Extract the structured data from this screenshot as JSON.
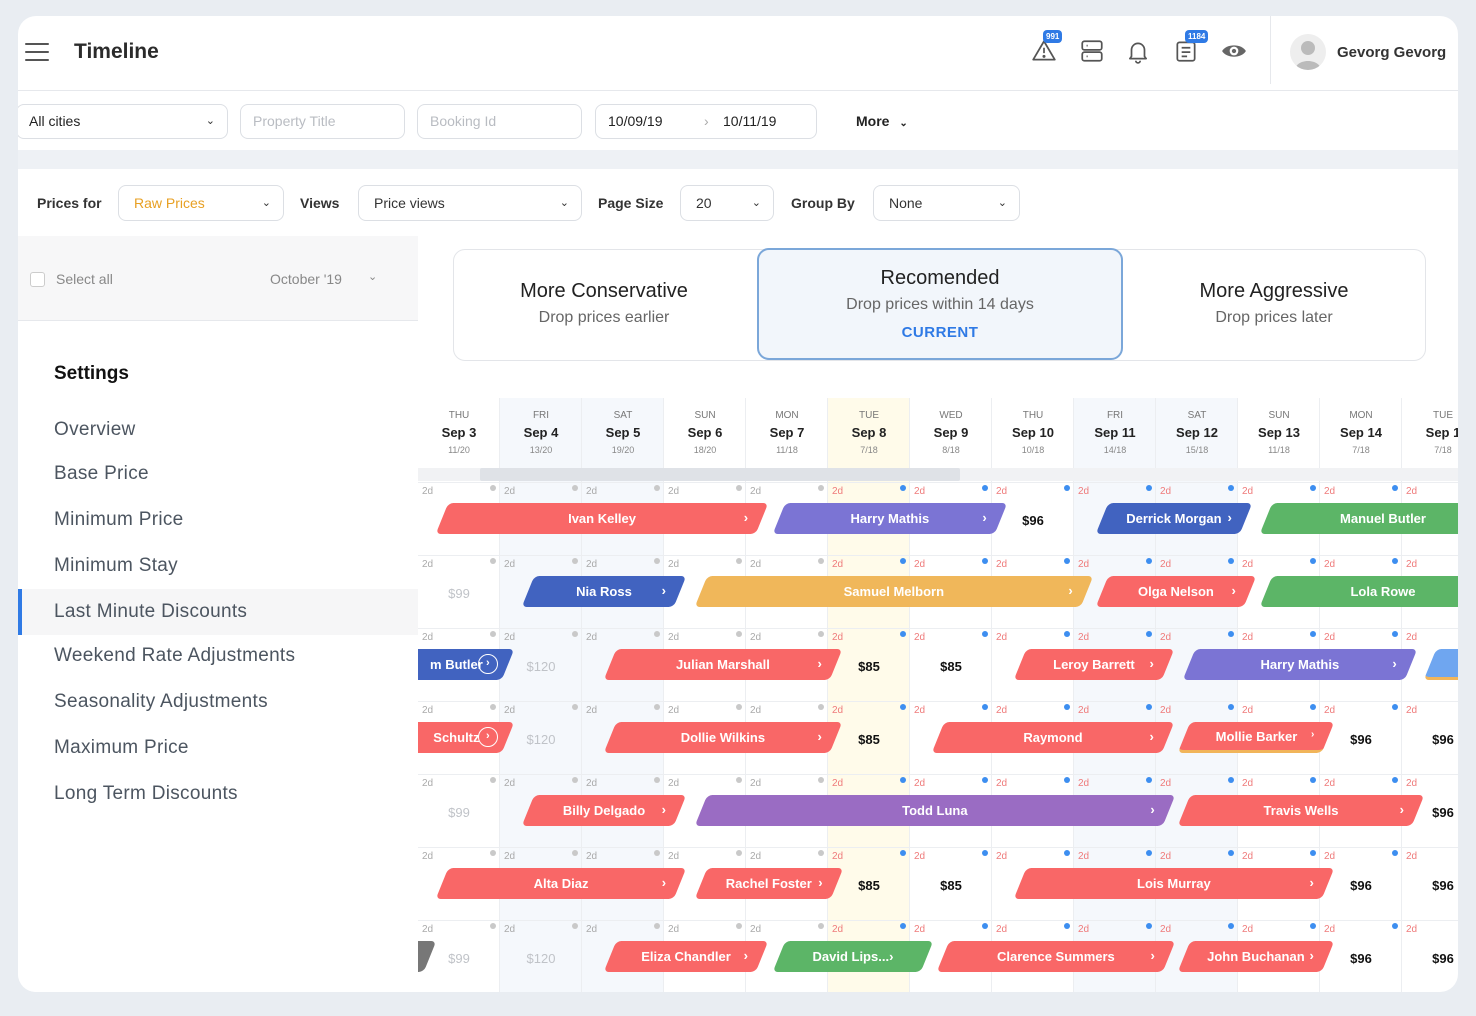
{
  "header": {
    "title": "Timeline",
    "user_name": "Gevorg Gevorg",
    "icons": [
      {
        "name": "alert-icon",
        "badge": "991"
      },
      {
        "name": "server-icon",
        "badge": null
      },
      {
        "name": "bell-icon",
        "badge": null
      },
      {
        "name": "document-icon",
        "badge": "1184"
      },
      {
        "name": "eye-icon",
        "badge": null
      }
    ]
  },
  "filters": {
    "city": "All cities",
    "property_title_placeholder": "Property Title",
    "booking_id_placeholder": "Booking Id",
    "date_from": "10/09/19",
    "date_to": "10/11/19",
    "more_label": "More"
  },
  "toolbar": {
    "prices_for_label": "Prices for",
    "prices_for_value": "Raw Prices",
    "views_label": "Views",
    "views_value": "Price views",
    "page_size_label": "Page Size",
    "page_size_value": "20",
    "group_by_label": "Group By",
    "group_by_value": "None"
  },
  "left_panel": {
    "select_all_label": "Select all",
    "month": "October '19",
    "settings_title": "Settings",
    "nav_items": [
      {
        "label": "Overview",
        "active": false
      },
      {
        "label": "Base Price",
        "active": false
      },
      {
        "label": "Minimum Price",
        "active": false
      },
      {
        "label": "Minimum Stay",
        "active": false
      },
      {
        "label": "Last Minute Discounts",
        "active": true
      },
      {
        "label": "Weekend Rate Adjustments",
        "active": false
      },
      {
        "label": "Seasonality Adjustments",
        "active": false
      },
      {
        "label": "Maximum Price",
        "active": false
      },
      {
        "label": "Long Term Discounts",
        "active": false
      }
    ]
  },
  "strategies": [
    {
      "title": "More Conservative",
      "subtitle": "Drop prices earlier"
    },
    {
      "title": "Recomended",
      "subtitle": "Drop prices within 14 days",
      "status": "CURRENT"
    },
    {
      "title": "More Aggressive",
      "subtitle": "Drop prices later"
    }
  ],
  "timeline": {
    "days": [
      {
        "dow": "THU",
        "date": "Sep 3",
        "occ": "11/20"
      },
      {
        "dow": "FRI",
        "date": "Sep 4",
        "occ": "13/20"
      },
      {
        "dow": "SAT",
        "date": "Sep 5",
        "occ": "19/20"
      },
      {
        "dow": "SUN",
        "date": "Sep 6",
        "occ": "18/20"
      },
      {
        "dow": "MON",
        "date": "Sep 7",
        "occ": "11/18"
      },
      {
        "dow": "TUE",
        "date": "Sep 8",
        "occ": "7/18"
      },
      {
        "dow": "WED",
        "date": "Sep 9",
        "occ": "8/18"
      },
      {
        "dow": "THU",
        "date": "Sep 10",
        "occ": "10/18"
      },
      {
        "dow": "FRI",
        "date": "Sep 11",
        "occ": "14/18"
      },
      {
        "dow": "SAT",
        "date": "Sep 12",
        "occ": "15/18"
      },
      {
        "dow": "SUN",
        "date": "Sep 13",
        "occ": "11/18"
      },
      {
        "dow": "MON",
        "date": "Sep 14",
        "occ": "7/18"
      },
      {
        "dow": "TUE",
        "date": "Sep 1",
        "occ": "7/18"
      }
    ],
    "min_stay": "2d",
    "colors": {
      "red": "#f96767",
      "purple": "#7b74d4",
      "blue": "#4163c0",
      "green": "#5cb567",
      "orange": "#f0b75a",
      "violet": "#9a6cc3",
      "lightblue": "#6fa6f0",
      "gray": "#777777"
    },
    "rows": [
      {
        "prices": [],
        "bookings": [
          {
            "guest": "Ivan Kelley",
            "color": "red",
            "start": 0.15,
            "end": 4.2,
            "icon": "arrow"
          },
          {
            "guest": "Harry Mathis",
            "color": "purple",
            "start": 4.25,
            "end": 7.1,
            "icon": "arrow"
          },
          {
            "guest": "Derrick Morgan",
            "color": "blue",
            "start": 8.2,
            "end": 10.1,
            "icon": "arrow"
          },
          {
            "guest": "Manuel Butler",
            "color": "green",
            "start": 10.2,
            "end": 13.2,
            "icon": "none"
          }
        ],
        "price_labels": [
          {
            "col": 7,
            "text": "$96",
            "muted": false
          }
        ]
      },
      {
        "bookings": [
          {
            "guest": "Nia Ross",
            "color": "blue",
            "start": 1.2,
            "end": 3.2,
            "icon": "arrow"
          },
          {
            "guest": "Samuel Melborn",
            "color": "orange",
            "start": 3.3,
            "end": 8.15,
            "icon": "arrow"
          },
          {
            "guest": "Olga Nelson",
            "color": "red",
            "start": 8.2,
            "end": 10.15,
            "icon": "arrow"
          },
          {
            "guest": "Lola Rowe",
            "color": "green",
            "start": 10.2,
            "end": 13.2,
            "icon": "none"
          }
        ],
        "price_labels": [
          {
            "col": 0,
            "text": "$99",
            "muted": true
          }
        ]
      },
      {
        "bookings": [
          {
            "guest": "m Butler",
            "color": "blue",
            "start": -0.3,
            "end": 1.1,
            "icon": "circle"
          },
          {
            "guest": "Julian Marshall",
            "color": "red",
            "start": 2.2,
            "end": 5.1,
            "icon": "arrow"
          },
          {
            "guest": "Leroy Barrett",
            "color": "red",
            "start": 7.2,
            "end": 9.15,
            "icon": "arrow"
          },
          {
            "guest": "Harry Mathis",
            "color": "purple",
            "start": 9.25,
            "end": 12.1,
            "icon": "arrow"
          },
          {
            "guest": "",
            "color": "lightblue",
            "start": 12.2,
            "end": 13.2,
            "icon": "none",
            "underline": true
          }
        ],
        "price_labels": [
          {
            "col": 1,
            "text": "$120",
            "muted": true
          },
          {
            "col": 5,
            "text": "$85",
            "muted": false
          },
          {
            "col": 6,
            "text": "$85",
            "muted": false
          }
        ]
      },
      {
        "bookings": [
          {
            "guest": "Schultz",
            "color": "red",
            "start": -0.3,
            "end": 1.1,
            "icon": "circle"
          },
          {
            "guest": "Dollie Wilkins",
            "color": "red",
            "start": 2.2,
            "end": 5.1,
            "icon": "arrow"
          },
          {
            "guest": "Raymond",
            "color": "red",
            "start": 6.2,
            "end": 9.15,
            "icon": "arrow"
          },
          {
            "guest": "Mollie Barker",
            "color": "red",
            "start": 9.2,
            "end": 11.1,
            "icon": "small-arrow",
            "underline": true
          }
        ],
        "price_labels": [
          {
            "col": 1,
            "text": "$120",
            "muted": true
          },
          {
            "col": 5,
            "text": "$85",
            "muted": false
          },
          {
            "col": 11,
            "text": "$96",
            "muted": false
          },
          {
            "col": 12,
            "text": "$96",
            "muted": false
          }
        ]
      },
      {
        "bookings": [
          {
            "guest": "Billy Delgado",
            "color": "red",
            "start": 1.2,
            "end": 3.2,
            "icon": "arrow"
          },
          {
            "guest": "Todd Luna",
            "color": "violet",
            "start": 3.3,
            "end": 9.15,
            "icon": "arrow"
          },
          {
            "guest": "Travis Wells",
            "color": "red",
            "start": 9.2,
            "end": 12.2,
            "icon": "arrow"
          }
        ],
        "price_labels": [
          {
            "col": 0,
            "text": "$99",
            "muted": true
          },
          {
            "col": 12,
            "text": "$96",
            "muted": false
          }
        ]
      },
      {
        "bookings": [
          {
            "guest": "Alta Diaz",
            "color": "red",
            "start": 0.15,
            "end": 3.2,
            "icon": "arrow"
          },
          {
            "guest": "Rachel Foster",
            "color": "red",
            "start": 3.3,
            "end": 5.1,
            "icon": "arrow"
          },
          {
            "guest": "Lois Murray",
            "color": "red",
            "start": 7.2,
            "end": 11.1,
            "icon": "arrow"
          }
        ],
        "price_labels": [
          {
            "col": 5,
            "text": "$85",
            "muted": false
          },
          {
            "col": 6,
            "text": "$85",
            "muted": false
          },
          {
            "col": 11,
            "text": "$96",
            "muted": false
          },
          {
            "col": 12,
            "text": "$96",
            "muted": false
          }
        ]
      },
      {
        "bookings": [
          {
            "guest": "",
            "color": "gray",
            "start": -0.3,
            "end": 0.15,
            "icon": "none"
          },
          {
            "guest": "Eliza Chandler",
            "color": "red",
            "start": 2.2,
            "end": 4.2,
            "icon": "arrow"
          },
          {
            "guest": "David Lips...",
            "color": "green",
            "start": 4.25,
            "end": 6.2,
            "icon": "inline-arrow"
          },
          {
            "guest": "Clarence Summers",
            "color": "red",
            "start": 6.25,
            "end": 9.15,
            "icon": "arrow"
          },
          {
            "guest": "John Buchanan",
            "color": "red",
            "start": 9.2,
            "end": 11.1,
            "icon": "arrow"
          }
        ],
        "price_labels": [
          {
            "col": 0,
            "text": "$99",
            "muted": true
          },
          {
            "col": 1,
            "text": "$120",
            "muted": true
          },
          {
            "col": 11,
            "text": "$96",
            "muted": false
          },
          {
            "col": 12,
            "text": "$96",
            "muted": false
          }
        ]
      }
    ]
  }
}
